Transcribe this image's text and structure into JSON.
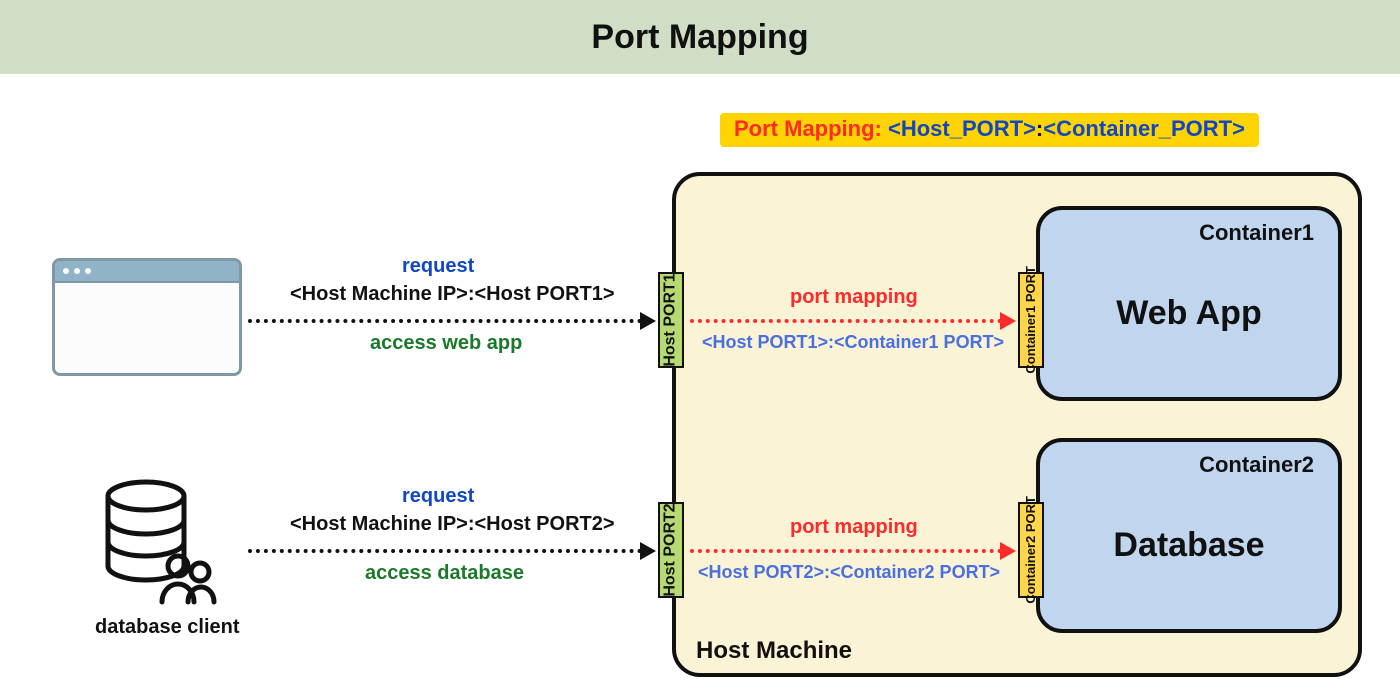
{
  "title": "Port Mapping",
  "syntax": {
    "prefix": "Port Mapping: ",
    "host": "<Host_PORT>",
    "colon": ":",
    "container": "<Container_PORT>"
  },
  "host_machine_label": "Host Machine",
  "containers": [
    {
      "label": "Container1",
      "main": "Web App",
      "port_label": "Container1 PORT"
    },
    {
      "label": "Container2",
      "main": "Database",
      "port_label": "Container2 PORT"
    }
  ],
  "host_ports": [
    {
      "label": "Host PORT1"
    },
    {
      "label": "Host PORT2"
    }
  ],
  "clients": [
    {
      "kind": "browser",
      "caption": "",
      "request_label": "request",
      "address": "<Host Machine IP>:<Host PORT1>",
      "purpose": "access web app",
      "mapping_label": "port mapping",
      "mapping_value": "<Host PORT1>:<Container1 PORT>"
    },
    {
      "kind": "dbclient",
      "caption": "database client",
      "request_label": "request",
      "address": "<Host Machine IP>:<Host PORT2>",
      "purpose": "access database",
      "mapping_label": "port mapping",
      "mapping_value": "<Host PORT2>:<Container2 PORT>"
    }
  ],
  "colors": {
    "title_bg": "#d0dec6",
    "highlight": "#ffd400",
    "host_bg": "#faf3d5",
    "container_bg": "#c0d5ee",
    "host_port_bg": "#b5da74",
    "ctr_port_bg": "#ffd64b",
    "red": "#ff2a2a",
    "blue": "#1146c4",
    "green": "#1b7a2a"
  }
}
